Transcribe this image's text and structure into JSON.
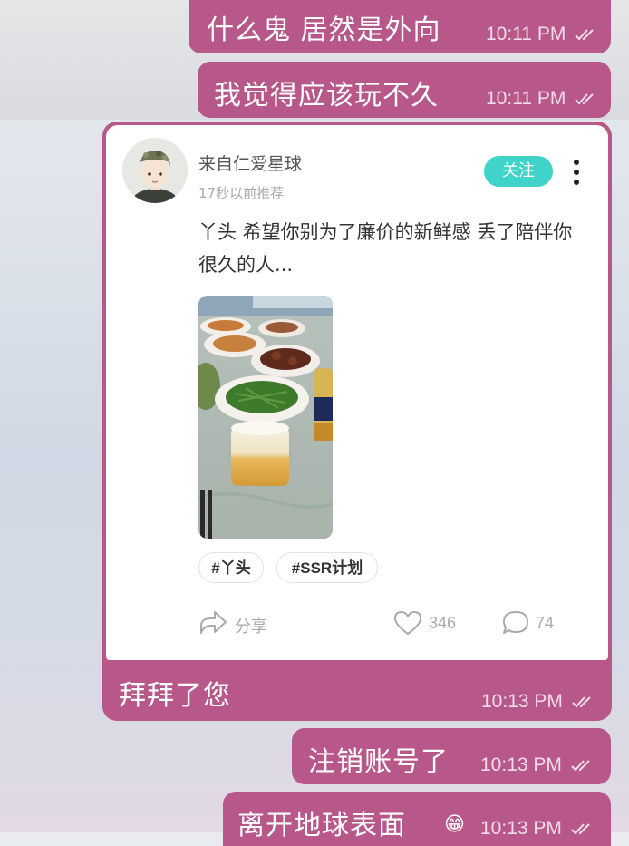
{
  "messages": [
    {
      "text": "什么鬼 居然是外向",
      "time": "10:11 PM"
    },
    {
      "text": "我觉得应该玩不久",
      "time": "10:11 PM"
    },
    {
      "text": "拜拜了您",
      "time": "10:13 PM"
    },
    {
      "text": "注销账号了",
      "time": "10:13 PM"
    },
    {
      "text": "离开地球表面",
      "emoji": "😁",
      "time": "10:13 PM"
    }
  ],
  "post": {
    "author": "来自仁爱星球",
    "time_ago": "17秒以前推荐",
    "follow_label": "关注",
    "text": "丫头 希望你别为了廉价的新鲜感 丢了陪伴你很久的人...",
    "tags": [
      "#丫头",
      "#SSR计划"
    ],
    "share_label": "分享",
    "like_count": "346",
    "comment_count": "74"
  },
  "colors": {
    "bubble": "#b8588a",
    "follow": "#3fd3c9"
  },
  "icons": [
    "double-check-icon",
    "more-vertical-icon",
    "share-icon",
    "heart-icon",
    "comment-icon"
  ]
}
